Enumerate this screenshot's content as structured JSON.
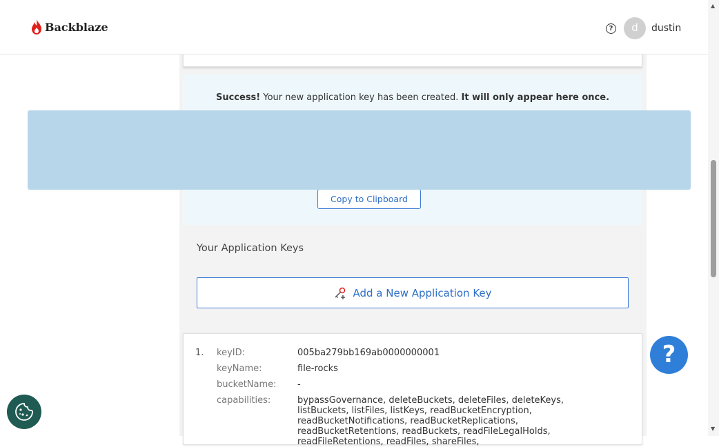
{
  "header": {
    "brand": "Backblaze",
    "help_label": "?",
    "avatar_initial": "d",
    "username": "dustin"
  },
  "success": {
    "strong_prefix": "Success!",
    "message": "Your new application key has been created.",
    "warning": "It will only appear here once.",
    "copy_button": "Copy to Clipboard"
  },
  "keys": {
    "heading": "Your Application Keys",
    "add_button": "Add a New Application Key",
    "items": [
      {
        "index": "1.",
        "keyID_label": "keyID:",
        "keyID": "005ba279bb169ab0000000001",
        "keyName_label": "keyName:",
        "keyName": "file-rocks",
        "bucketName_label": "bucketName:",
        "bucketName": "-",
        "capabilities_label": "capabilities:",
        "capabilities": "bypassGovernance, deleteBuckets, deleteFiles, deleteKeys, listBuckets, listFiles, listKeys, readBucketEncryption, readBucketNotifications, readBucketReplications, readBucketRetentions, readBuckets, readFileLegalHolds, readFileRetentions, readFiles, shareFiles,"
      }
    ]
  },
  "floating": {
    "help_fab": "?"
  },
  "colors": {
    "accent": "#2e6fc7",
    "success_bg": "#eef8fc",
    "overlay": "#b8d6ea",
    "brand_red": "#e0201b"
  },
  "icons": {
    "logo": "flame-icon",
    "cookie": "cookie-icon",
    "add_key": "key-add-icon"
  }
}
